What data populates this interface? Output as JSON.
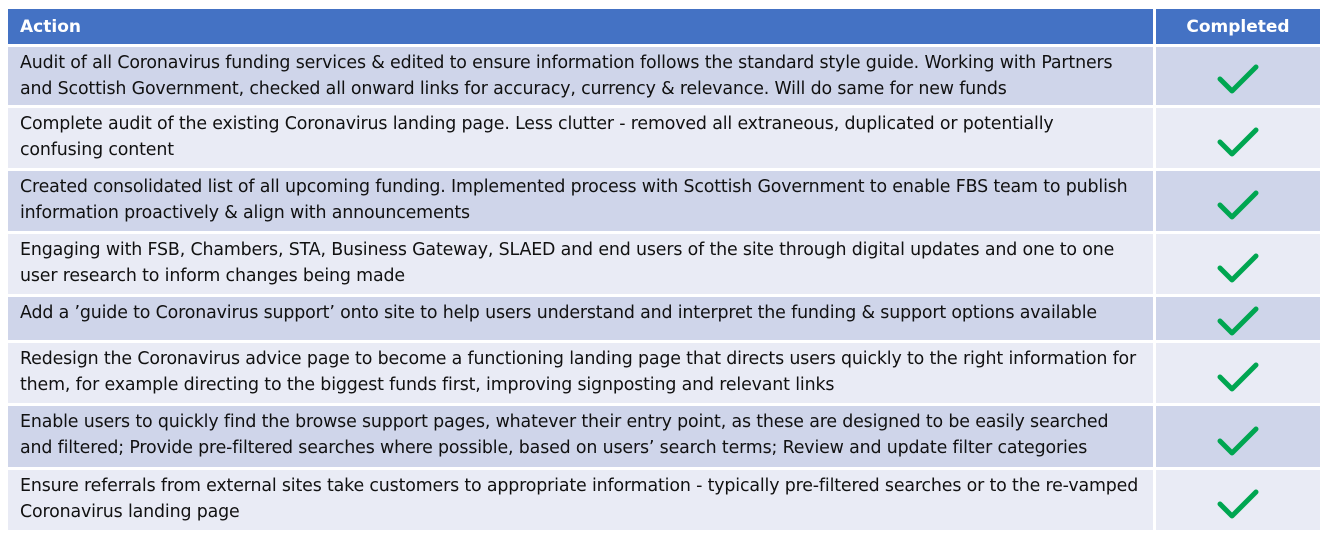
{
  "table": {
    "headers": {
      "action": "Action",
      "completed": "Completed"
    },
    "rows": [
      {
        "action": "Audit of all Coronavirus funding services & edited to ensure information follows the standard style guide. Working with Partners and Scottish Government, checked all onward links for accuracy, currency & relevance. Will do same for new funds",
        "completed": true
      },
      {
        "action": "Complete audit of the existing Coronavirus landing page. Less clutter - removed all extraneous, duplicated or potentially confusing content",
        "completed": true
      },
      {
        "action": "Created consolidated list of all upcoming funding. Implemented process with Scottish Government to enable FBS team to publish information proactively & align with announcements",
        "completed": true
      },
      {
        "action": "Engaging with FSB, Chambers, STA, Business Gateway, SLAED and end users of the site through digital updates and one to one user research to inform changes being made",
        "completed": true
      },
      {
        "action": "Add a ’guide to Coronavirus support’ onto site to help users understand and interpret the funding & support options available",
        "completed": true
      },
      {
        "action": "Redesign the Coronavirus advice page to become a functioning landing page that directs users quickly to the right information for them, for example directing to the biggest funds first, improving signposting and relevant links",
        "completed": true
      },
      {
        "action": "Enable users to quickly find the browse support pages, whatever their entry point, as these are designed to be easily searched and filtered; Provide pre-filtered searches where possible, based on users’ search terms; Review and update filter categories",
        "completed": true
      },
      {
        "action": "Ensure referrals from external sites take customers to appropriate information - typically pre-filtered searches or to the re-vamped Coronavirus landing page",
        "completed": true
      }
    ],
    "check_icon": "checkmark-icon",
    "colors": {
      "header_bg": "#4472c4",
      "row_odd_bg": "#cfd5ea",
      "row_even_bg": "#e9ebf5",
      "check": "#00a651"
    }
  }
}
